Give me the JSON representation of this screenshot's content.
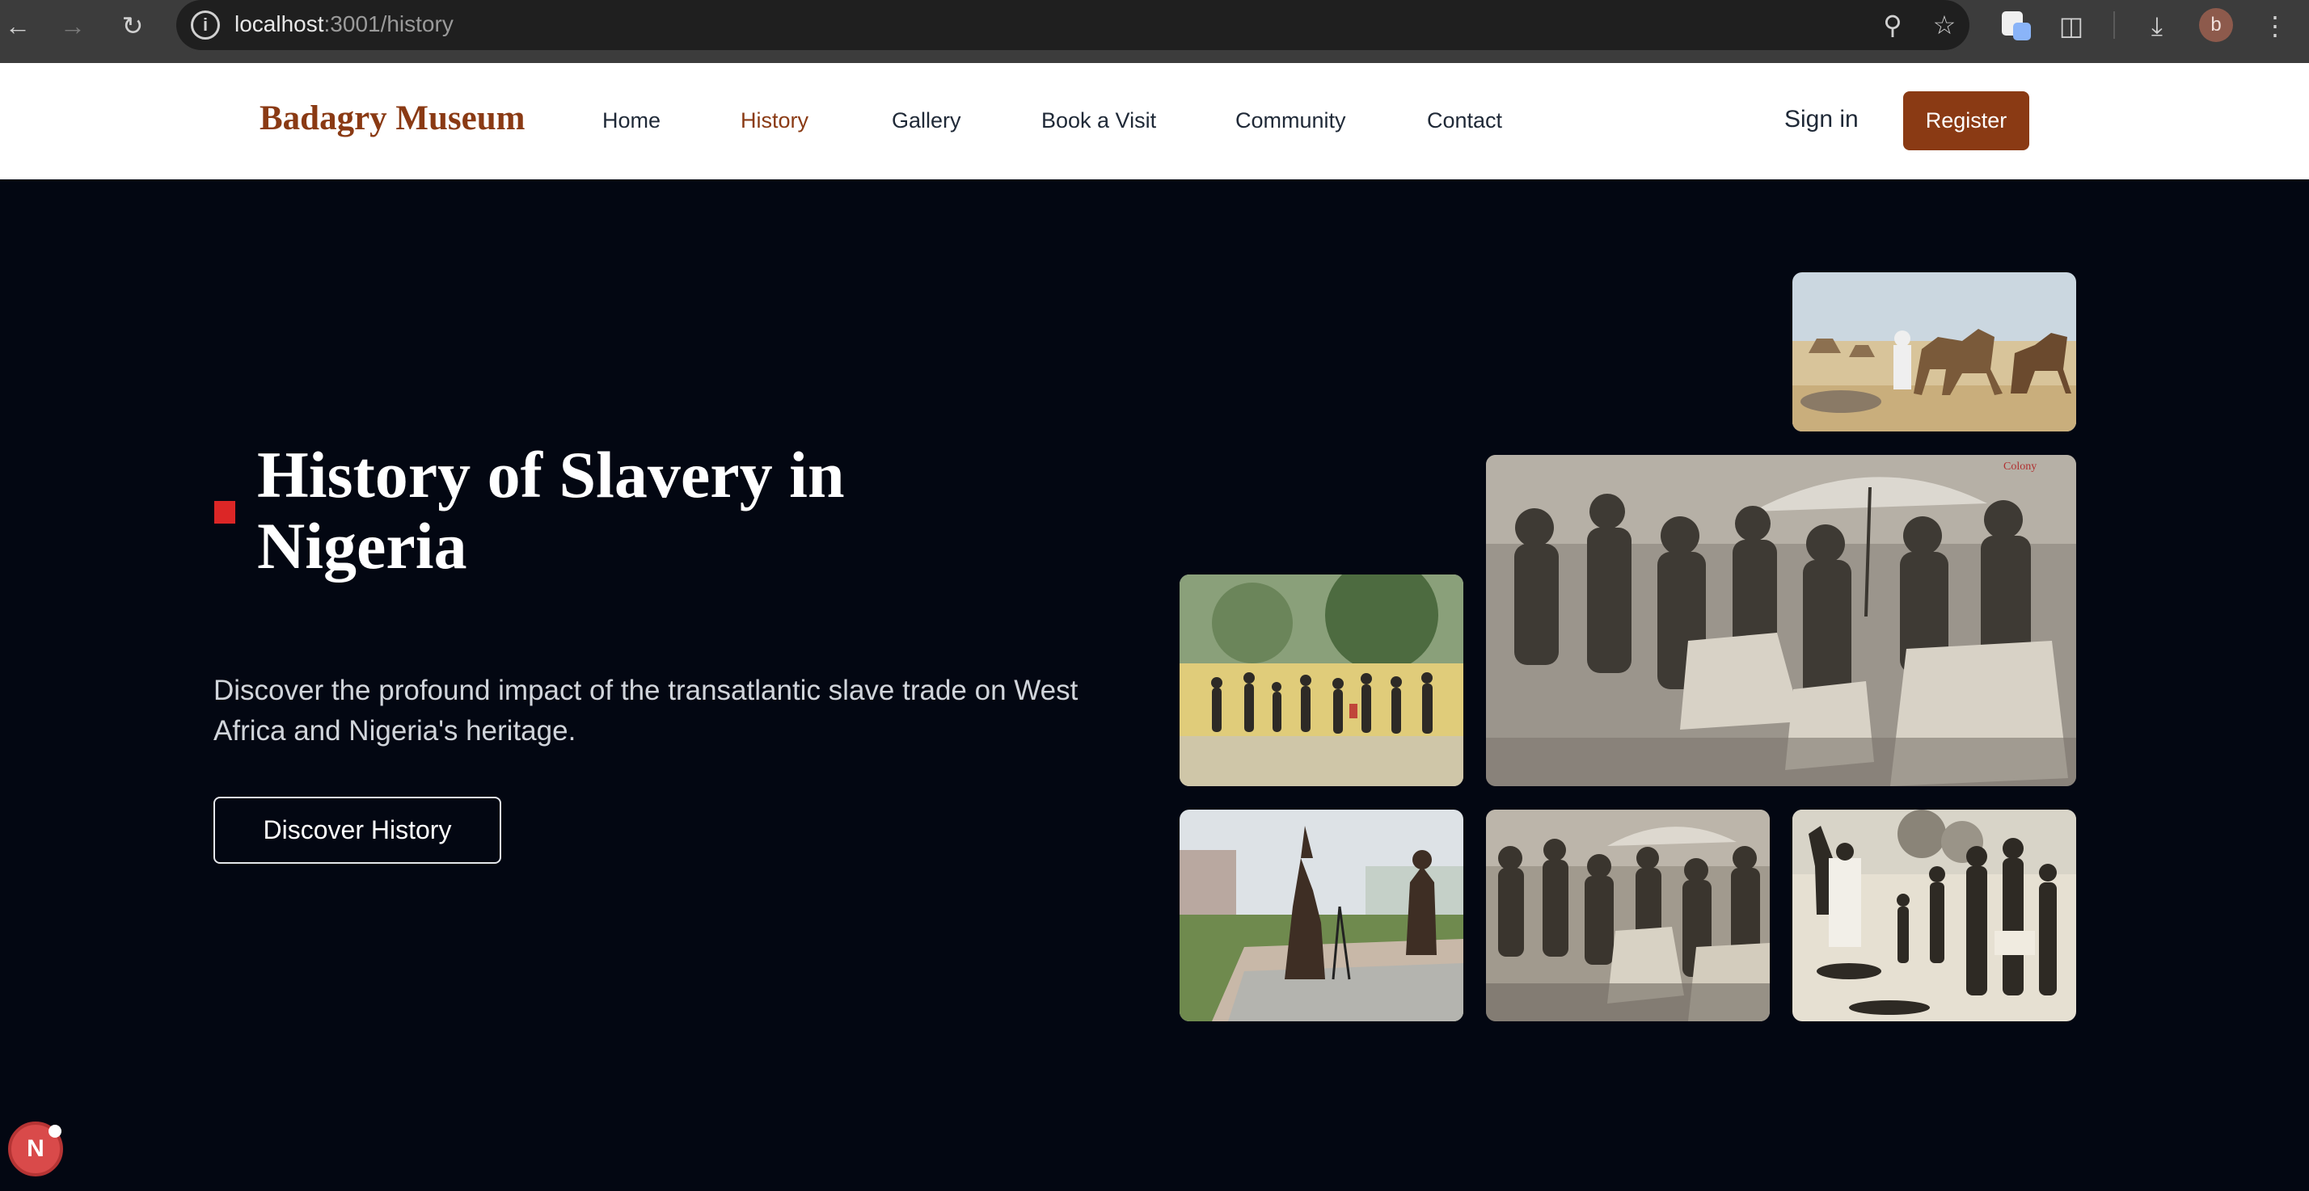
{
  "browser": {
    "url_host": "localhost",
    "url_path": ":3001/history",
    "avatar_letter": "b"
  },
  "header": {
    "brand": "Badagry Museum",
    "nav": [
      "Home",
      "History",
      "Gallery",
      "Book a Visit",
      "Community",
      "Contact"
    ],
    "active_nav": "History",
    "sign_in": "Sign in",
    "register": "Register"
  },
  "hero": {
    "title": "History of Slavery in Nigeria",
    "description": "Discover the profound impact of the transatlantic slave trade on West Africa and Nigeria's heritage.",
    "cta": "Discover History"
  },
  "gallery": {
    "images": [
      {
        "name": "caravan-desert-image",
        "stamp": ""
      },
      {
        "name": "crowd-with-umbrella-image",
        "stamp": "Colony"
      },
      {
        "name": "captives-march-image",
        "stamp": ""
      },
      {
        "name": "badagry-statues-image",
        "stamp": ""
      },
      {
        "name": "crowd-small-image",
        "stamp": ""
      },
      {
        "name": "beach-captives-image",
        "stamp": ""
      }
    ]
  },
  "dev": {
    "badge_letter": "N"
  },
  "colors": {
    "brand": "#8a3a14",
    "hero_bg": "#030712",
    "accent_marker": "#dc2626"
  }
}
